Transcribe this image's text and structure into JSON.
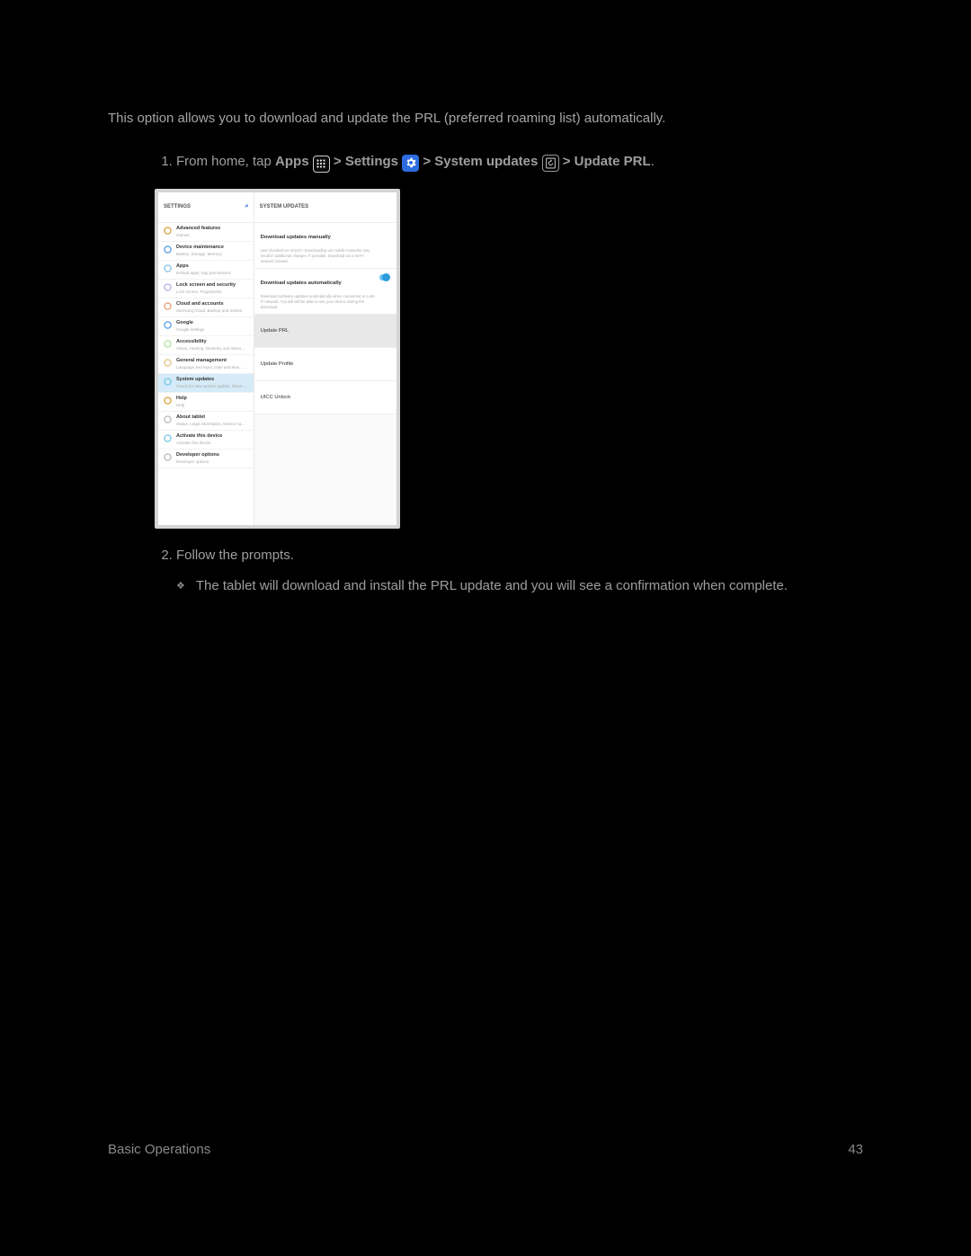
{
  "intro": "This option allows you to download and update the PRL (preferred roaming list) automatically.",
  "step1": {
    "prefix": "From home, tap ",
    "apps": "Apps",
    "arrow": " > ",
    "settings": "Settings",
    "system_updates": "System updates",
    "update_prl": "Update PRL",
    "period": "."
  },
  "screenshot": {
    "left_header": "SETTINGS",
    "right_header": "SYSTEM UPDATES",
    "left_items": [
      {
        "icon_color": "#d9a441",
        "label": "Advanced features",
        "sub": "Games"
      },
      {
        "icon_color": "#5aa0e6",
        "label": "Device maintenance",
        "sub": "Battery, Storage, Memory"
      },
      {
        "icon_color": "#8fc4e8",
        "label": "Apps",
        "sub": "Default apps, App permissions"
      },
      {
        "icon_color": "#b9b1e8",
        "label": "Lock screen and security",
        "sub": "Lock screen, Fingerprints"
      },
      {
        "icon_color": "#e8a17a",
        "label": "Cloud and accounts",
        "sub": "Samsung Cloud, Backup and restore"
      },
      {
        "icon_color": "#5aa0e6",
        "label": "Google",
        "sub": "Google settings"
      },
      {
        "icon_color": "#b5e39b",
        "label": "Accessibility",
        "sub": "Vision, Hearing, Dexterity and interaction"
      },
      {
        "icon_color": "#e8c48a",
        "label": "General management",
        "sub": "Language and input, Date and time, Res…"
      },
      {
        "icon_color": "#7bc7e8",
        "label": "System updates",
        "sub": "Check for new system update, Show sy…",
        "selected": true
      },
      {
        "icon_color": "#d9a441",
        "label": "Help",
        "sub": "Help"
      },
      {
        "icon_color": "#bbb",
        "label": "About tablet",
        "sub": "Status, Legal information, Device name"
      },
      {
        "icon_color": "#7bc7e8",
        "label": "Activate this device",
        "sub": "Activate this device"
      },
      {
        "icon_color": "#bbb",
        "label": "Developer options",
        "sub": "Developer options"
      }
    ],
    "right_block1": {
      "title": "Download updates manually",
      "desc": "Last checked on: 6/11/17\nDownloading via mobile networks may result in additional charges. If possible, download via a Wi-Fi network instead."
    },
    "right_block2": {
      "title": "Download updates automatically",
      "desc": "Download software updates automatically when connected to a Wi-Fi network. You will still be able to use your device during the download."
    },
    "right_rows": [
      {
        "label": "Update PRL",
        "highlight": true
      },
      {
        "label": "Update Profile"
      },
      {
        "label": "UICC Unlock"
      }
    ]
  },
  "step2": "Follow the prompts.",
  "bullet": "The tablet will download and install the PRL update and you will see a confirmation when complete.",
  "footer_left": "Basic Operations",
  "footer_right": "43"
}
